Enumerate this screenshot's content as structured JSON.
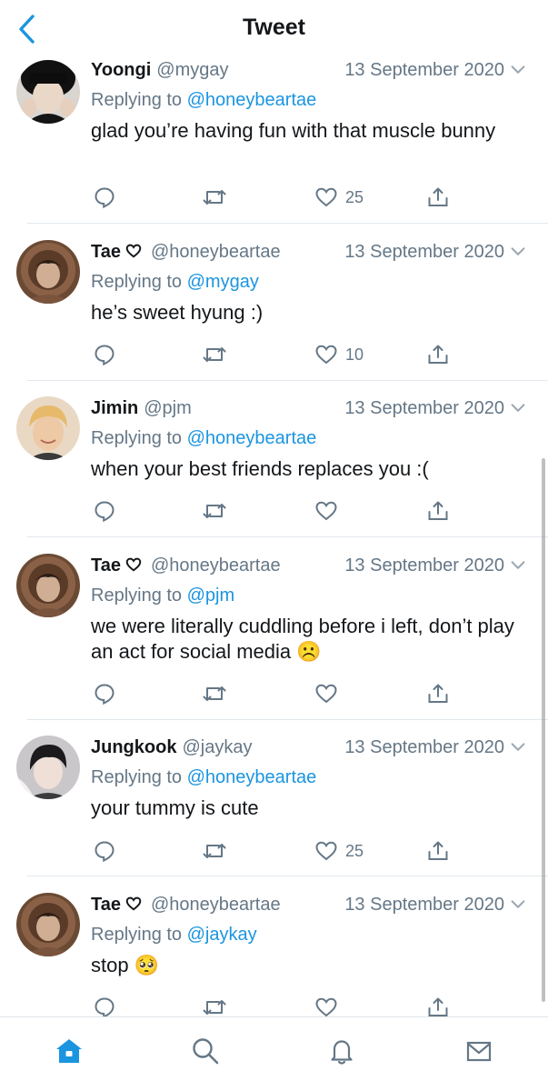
{
  "header": {
    "title": "Tweet"
  },
  "colors": {
    "accent": "#1b95e0",
    "secondary_text": "#657786",
    "divider": "#e1e8ed"
  },
  "tweets": [
    {
      "name": "Yoongi",
      "heart": false,
      "handle": "@mygay",
      "date": "13 September 2020",
      "replying_prefix": "Replying to ",
      "replying_to": "@honeybeartae",
      "text": "glad you’re having fun with that muscle bunny",
      "likes": "25",
      "avatar": "yoongi-avatar"
    },
    {
      "name": "Tae",
      "heart": true,
      "handle": "@honeybeartae",
      "date": "13 September 2020",
      "replying_prefix": "Replying to ",
      "replying_to": "@mygay",
      "text": "he’s sweet hyung :)",
      "likes": "10",
      "avatar": "tae-avatar"
    },
    {
      "name": "Jimin",
      "heart": false,
      "handle": "@pjm",
      "date": "13 September 2020",
      "replying_prefix": "Replying to ",
      "replying_to": "@honeybeartae",
      "text": "when your best friends replaces you :(",
      "likes": "",
      "avatar": "jimin-avatar"
    },
    {
      "name": "Tae",
      "heart": true,
      "handle": "@honeybeartae",
      "date": "13 September 2020",
      "replying_prefix": "Replying to ",
      "replying_to": "@pjm",
      "text": "we were literally cuddling before i left, don’t play an act for social media ☹️",
      "likes": "",
      "avatar": "tae-avatar"
    },
    {
      "name": "Jungkook",
      "heart": false,
      "handle": "@jaykay",
      "date": "13 September 2020",
      "replying_prefix": "Replying to ",
      "replying_to": "@honeybeartae",
      "text": "your tummy is cute",
      "likes": "25",
      "avatar": "jungkook-avatar"
    },
    {
      "name": "Tae",
      "heart": true,
      "handle": "@honeybeartae",
      "date": "13 September 2020",
      "replying_prefix": "Replying to ",
      "replying_to": "@jaykay",
      "text": "stop 🥺",
      "likes": "",
      "avatar": "tae-avatar"
    }
  ],
  "tabbar": {
    "items": [
      "home-icon",
      "search-icon",
      "bell-icon",
      "mail-icon"
    ],
    "active": "home-icon"
  }
}
